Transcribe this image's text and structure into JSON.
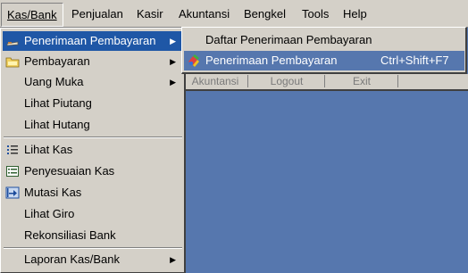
{
  "menubar": {
    "items": [
      {
        "label": "Kas/Bank"
      },
      {
        "label": "Penjualan"
      },
      {
        "label": "Kasir"
      },
      {
        "label": "Akuntansi"
      },
      {
        "label": "Bengkel"
      },
      {
        "label": "Tools"
      },
      {
        "label": "Help"
      }
    ]
  },
  "toolbar": {
    "buttons": [
      {
        "label": "Akuntansi"
      },
      {
        "label": "Logout"
      },
      {
        "label": "Exit"
      }
    ]
  },
  "menu": {
    "items": [
      {
        "label": "Penerimaan Pembayaran",
        "icon": "receipt-icon"
      },
      {
        "label": "Pembayaran",
        "icon": "folder-icon"
      },
      {
        "label": "Uang Muka"
      },
      {
        "label": "Lihat Piutang"
      },
      {
        "label": "Lihat Hutang"
      },
      {
        "label": "Lihat Kas",
        "icon": "list-icon"
      },
      {
        "label": "Penyesuaian Kas",
        "icon": "ledger-icon"
      },
      {
        "label": "Mutasi Kas",
        "icon": "transfer-icon"
      },
      {
        "label": "Lihat Giro"
      },
      {
        "label": "Rekonsiliasi Bank"
      },
      {
        "label": "Laporan Kas/Bank"
      }
    ]
  },
  "submenu": {
    "items": [
      {
        "label": "Daftar Penerimaan Pembayaran",
        "shortcut": ""
      },
      {
        "label": "Penerimaan Pembayaran",
        "shortcut": "Ctrl+Shift+F7",
        "icon": "payment-icon"
      }
    ]
  },
  "colors": {
    "desktop": "#5677ae",
    "menu_bg": "#d4d0c8",
    "highlight": "#1f57a6"
  }
}
